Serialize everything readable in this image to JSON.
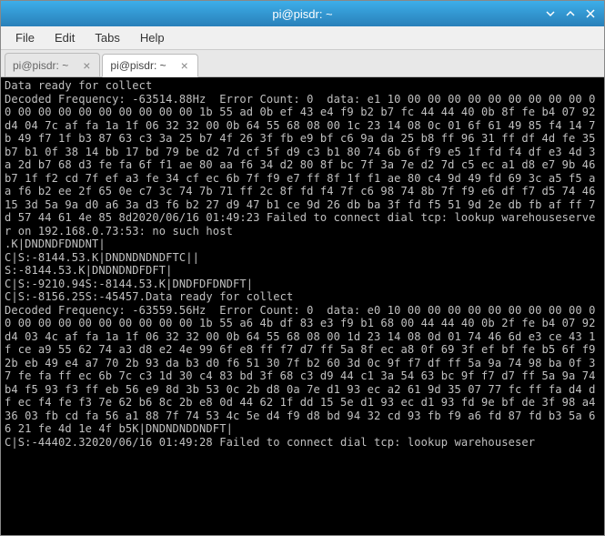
{
  "titlebar": {
    "title": "pi@pisdr: ~"
  },
  "menubar": {
    "file": "File",
    "edit": "Edit",
    "tabs": "Tabs",
    "help": "Help"
  },
  "tabs": [
    {
      "label": "pi@pisdr: ~",
      "active": false
    },
    {
      "label": "pi@pisdr: ~",
      "active": true
    }
  ],
  "terminal_lines": [
    "Data ready for collect",
    "Decoded Frequency: -63514.88Hz  Error Count: 0  data: e1 10 00 00 00 00 00 00 00 00 00 00 00 00 00 00 00 00 00 00 00 1b 55 ad 0b ef 43 e4 f9 b2 b7 fc 44 44 40 0b 8f fe b4 07 92 d4 04 7c af fa 1a 1f 06 32 32 00 0b 64 55 68 08 00 1c 23 14 08 0c 01 6f 61 49 85 f4 14 7b 49 f7 1f b3 87 63 c3 3a 25 b7 4f 26 3f fb e9 bf c6 9a da 25 b8 ff 96 31 ff df 4d fe 35 b7 b1 0f 38 14 bb 17 bd 79 be d2 7d cf 5f d9 c3 b1 80 74 6b 6f f9 e5 1f fd f4 df e3 4d 3a 2d b7 68 d3 fe fa 6f f1 ae 80 aa f6 34 d2 80 8f bc 7f 3a 7e d2 7d c5 ec a1 d8 e7 9b 46 b7 1f f2 cd 7f ef a3 fe 34 cf ec 6b 7f f9 e7 ff 8f 1f f1 ae 80 c4 9d 49 fd 69 3c a5 f5 aa f6 b2 ee 2f 65 0e c7 3c 74 7b 71 ff 2c 8f fd f4 7f c6 98 74 8b 7f f9 e6 df f7 d5 74 46 15 3d 5a 9a d0 a6 3a d3 f6 b2 27 d9 47 b1 ce 9d 26 db ba 3f fd f5 51 9d 2e db fb af ff 7d 57 44 61 4e 85 8d2020/06/16 01:49:23 Failed to connect dial tcp: lookup warehouseserver on 192.168.0.73:53: no such host",
    ".K|DNDNDFDNDNT|",
    "C|S:-8144.53.K|DNDNDNDNDFTC||",
    "S:-8144.53.K|DNDNDNDFDFT|",
    "C|S:-9210.94S:-8144.53.K|DNDFDFDNDFT|",
    "C|S:-8156.25S:-45457.Data ready for collect",
    "Decoded Frequency: -63559.56Hz  Error Count: 0  data: e0 10 00 00 00 00 00 00 00 00 00 00 00 00 00 00 00 00 00 00 00 1b 55 a6 4b df 83 e3 f9 b1 68 00 44 44 40 0b 2f fe b4 07 92 d4 03 4c af fa 1a 1f 06 32 32 00 0b 64 55 68 08 00 1d 23 14 08 0d 01 74 46 6d e3 ce 43 1f ce a9 55 62 74 a3 d8 e2 4e 99 6f e8 ff f7 d7 ff 5a 8f ec a8 0f 69 3f ef bf fe b5 6f f9 2b eb 49 e4 a7 70 2b 93 da b3 d0 f6 51 30 7f b2 60 3d 0c 9f f7 df ff 5a 9a 74 98 ba 0f 37 fe fa ff ec 6b 7c c3 1d 30 c4 83 bd 3f 68 c3 d9 44 c1 3a 54 63 bc 9f f7 d7 ff 5a 9a 74 b4 f5 93 f3 ff eb 56 e9 8d 3b 53 0c 2b d8 0a 7e d1 93 ec a2 61 9d 35 07 77 fc ff fa d4 df ec f4 fe f3 7e 62 b6 8c 2b e8 0d 44 62 1f dd 15 5e d1 93 ec d1 93 fd 9e bf de 3f 98 a4 36 03 fb cd fa 56 a1 88 7f 74 53 4c 5e d4 f9 d8 bd 94 32 cd 93 fb f9 a6 fd 87 fd b3 5a 66 21 fe 4d 1e 4f b5K|DNDNDNDDNDFT|",
    "C|S:-44402.32020/06/16 01:49:28 Failed to connect dial tcp: lookup warehouseser"
  ]
}
